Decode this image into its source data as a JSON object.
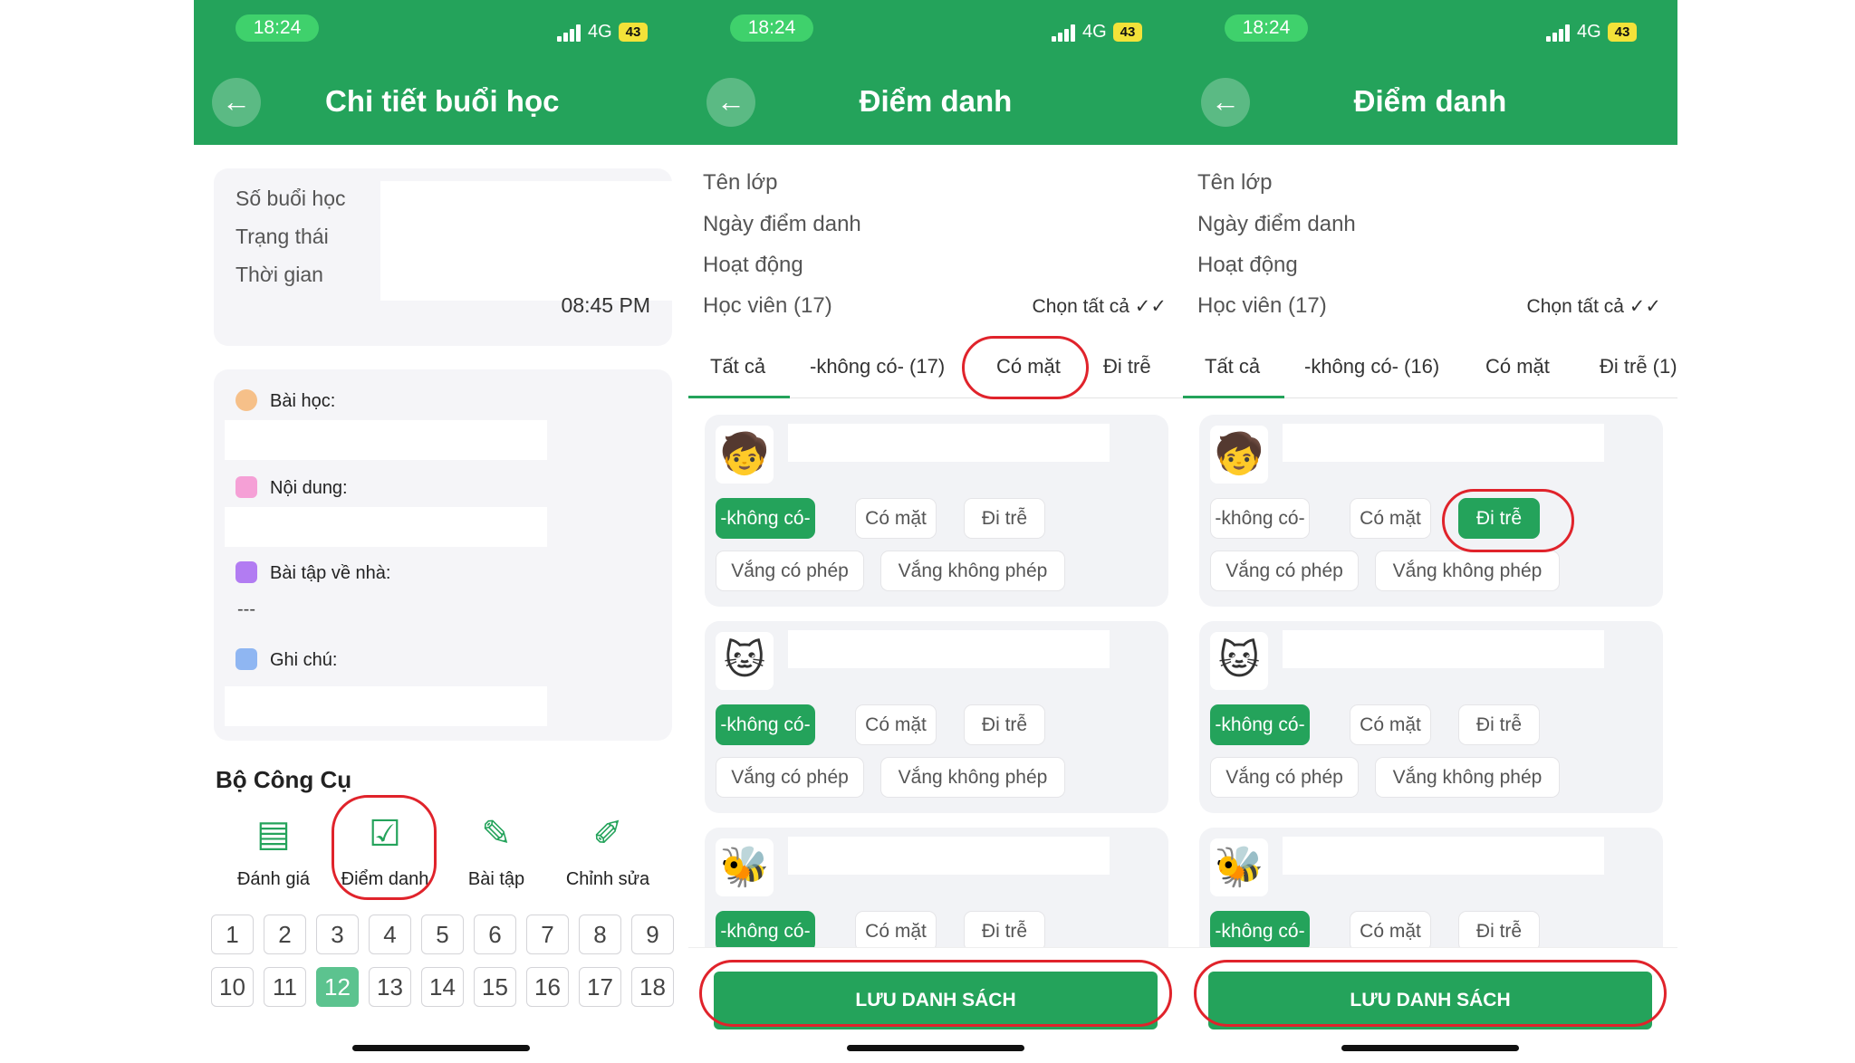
{
  "status_bar": {
    "time": "18:24",
    "network": "4G",
    "battery": "43"
  },
  "screen1": {
    "title": "Chi tiết buổi học",
    "info_labels": [
      "Số buổi học",
      "Trạng thái",
      "Thời gian"
    ],
    "time_value": "08:45 PM",
    "sections": {
      "lesson": "Bài học:",
      "content": "Nội dung:",
      "homework": "Bài tập về nhà:",
      "homework_value": "---",
      "note": "Ghi chú:"
    },
    "tools_title": "Bộ Công Cụ",
    "tools": [
      "Đánh giá",
      "Điểm danh",
      "Bài tập",
      "Chỉnh sửa"
    ],
    "numbers_row1": [
      "1",
      "2",
      "3",
      "4",
      "5",
      "6",
      "7",
      "8",
      "9"
    ],
    "numbers_row2": [
      "10",
      "11",
      "12",
      "13",
      "14",
      "15",
      "16",
      "17",
      "18"
    ],
    "active_number": "12"
  },
  "attendance": {
    "title": "Điểm danh",
    "rows": [
      "Tên lớp",
      "Ngày điểm danh",
      "Hoạt động",
      "Học viên (17)"
    ],
    "select_all": "Chọn tất cả",
    "status_options": [
      "-không có-",
      "Có mặt",
      "Đi trễ",
      "Vắng có phép",
      "Vắng không phép"
    ],
    "save_label": "LƯU DANH SÁCH"
  },
  "screen2_tabs": [
    "Tất cả",
    "-không có- (17)",
    "Có mặt",
    "Đi trễ"
  ],
  "screen3_tabs": [
    "Tất cả",
    "-không có- (16)",
    "Có mặt",
    "Đi trễ (1)"
  ],
  "colors": {
    "primary": "#24a35b",
    "highlight": "#e0232b",
    "status_pill": "#3fd16c"
  }
}
